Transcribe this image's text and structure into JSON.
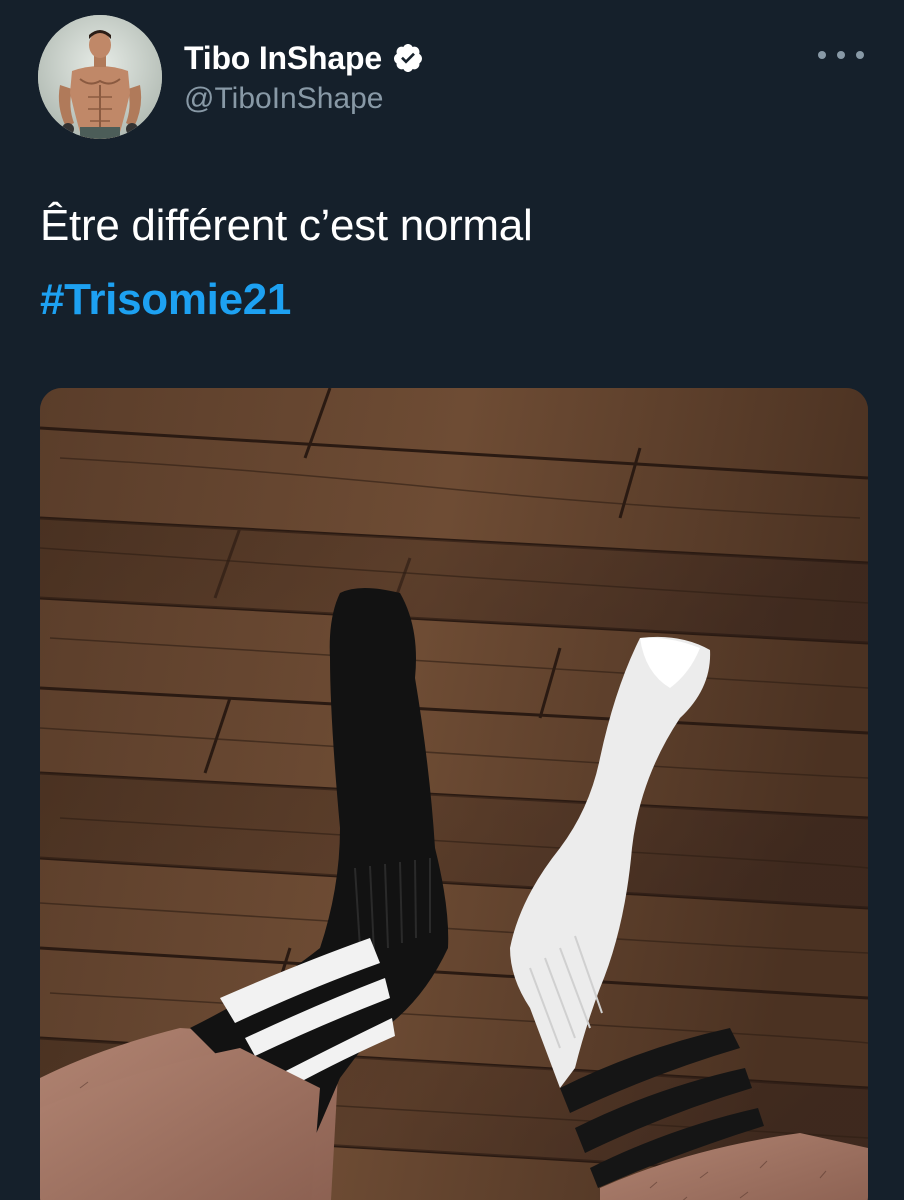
{
  "tweet": {
    "author": {
      "display_name": "Tibo InShape",
      "handle": "@TiboInShape",
      "verified": true,
      "avatar_icon": "profile-photo"
    },
    "more_icon": "more-horizontal-icon",
    "text": "Être différent c’est normal",
    "hashtag": "#Trisomie21",
    "media": {
      "alt_icon": "photo-black-and-white-socks-on-wooden-floor"
    }
  },
  "colors": {
    "background": "#15202b",
    "text": "#ffffff",
    "secondary_text": "#8899a6",
    "link": "#1da1f2",
    "verified_badge": "#ffffff"
  }
}
